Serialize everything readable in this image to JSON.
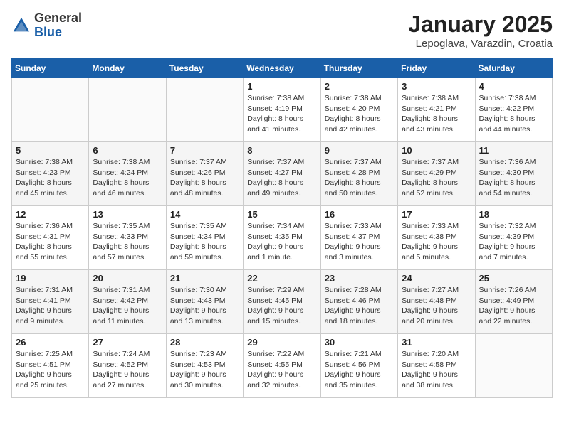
{
  "header": {
    "logo": {
      "general": "General",
      "blue": "Blue"
    },
    "title": "January 2025",
    "location": "Lepoglava, Varazdin, Croatia"
  },
  "weekdays": [
    "Sunday",
    "Monday",
    "Tuesday",
    "Wednesday",
    "Thursday",
    "Friday",
    "Saturday"
  ],
  "weeks": [
    [
      {
        "day": "",
        "info": ""
      },
      {
        "day": "",
        "info": ""
      },
      {
        "day": "",
        "info": ""
      },
      {
        "day": "1",
        "info": "Sunrise: 7:38 AM\nSunset: 4:19 PM\nDaylight: 8 hours\nand 41 minutes."
      },
      {
        "day": "2",
        "info": "Sunrise: 7:38 AM\nSunset: 4:20 PM\nDaylight: 8 hours\nand 42 minutes."
      },
      {
        "day": "3",
        "info": "Sunrise: 7:38 AM\nSunset: 4:21 PM\nDaylight: 8 hours\nand 43 minutes."
      },
      {
        "day": "4",
        "info": "Sunrise: 7:38 AM\nSunset: 4:22 PM\nDaylight: 8 hours\nand 44 minutes."
      }
    ],
    [
      {
        "day": "5",
        "info": "Sunrise: 7:38 AM\nSunset: 4:23 PM\nDaylight: 8 hours\nand 45 minutes."
      },
      {
        "day": "6",
        "info": "Sunrise: 7:38 AM\nSunset: 4:24 PM\nDaylight: 8 hours\nand 46 minutes."
      },
      {
        "day": "7",
        "info": "Sunrise: 7:37 AM\nSunset: 4:26 PM\nDaylight: 8 hours\nand 48 minutes."
      },
      {
        "day": "8",
        "info": "Sunrise: 7:37 AM\nSunset: 4:27 PM\nDaylight: 8 hours\nand 49 minutes."
      },
      {
        "day": "9",
        "info": "Sunrise: 7:37 AM\nSunset: 4:28 PM\nDaylight: 8 hours\nand 50 minutes."
      },
      {
        "day": "10",
        "info": "Sunrise: 7:37 AM\nSunset: 4:29 PM\nDaylight: 8 hours\nand 52 minutes."
      },
      {
        "day": "11",
        "info": "Sunrise: 7:36 AM\nSunset: 4:30 PM\nDaylight: 8 hours\nand 54 minutes."
      }
    ],
    [
      {
        "day": "12",
        "info": "Sunrise: 7:36 AM\nSunset: 4:31 PM\nDaylight: 8 hours\nand 55 minutes."
      },
      {
        "day": "13",
        "info": "Sunrise: 7:35 AM\nSunset: 4:33 PM\nDaylight: 8 hours\nand 57 minutes."
      },
      {
        "day": "14",
        "info": "Sunrise: 7:35 AM\nSunset: 4:34 PM\nDaylight: 8 hours\nand 59 minutes."
      },
      {
        "day": "15",
        "info": "Sunrise: 7:34 AM\nSunset: 4:35 PM\nDaylight: 9 hours\nand 1 minute."
      },
      {
        "day": "16",
        "info": "Sunrise: 7:33 AM\nSunset: 4:37 PM\nDaylight: 9 hours\nand 3 minutes."
      },
      {
        "day": "17",
        "info": "Sunrise: 7:33 AM\nSunset: 4:38 PM\nDaylight: 9 hours\nand 5 minutes."
      },
      {
        "day": "18",
        "info": "Sunrise: 7:32 AM\nSunset: 4:39 PM\nDaylight: 9 hours\nand 7 minutes."
      }
    ],
    [
      {
        "day": "19",
        "info": "Sunrise: 7:31 AM\nSunset: 4:41 PM\nDaylight: 9 hours\nand 9 minutes."
      },
      {
        "day": "20",
        "info": "Sunrise: 7:31 AM\nSunset: 4:42 PM\nDaylight: 9 hours\nand 11 minutes."
      },
      {
        "day": "21",
        "info": "Sunrise: 7:30 AM\nSunset: 4:43 PM\nDaylight: 9 hours\nand 13 minutes."
      },
      {
        "day": "22",
        "info": "Sunrise: 7:29 AM\nSunset: 4:45 PM\nDaylight: 9 hours\nand 15 minutes."
      },
      {
        "day": "23",
        "info": "Sunrise: 7:28 AM\nSunset: 4:46 PM\nDaylight: 9 hours\nand 18 minutes."
      },
      {
        "day": "24",
        "info": "Sunrise: 7:27 AM\nSunset: 4:48 PM\nDaylight: 9 hours\nand 20 minutes."
      },
      {
        "day": "25",
        "info": "Sunrise: 7:26 AM\nSunset: 4:49 PM\nDaylight: 9 hours\nand 22 minutes."
      }
    ],
    [
      {
        "day": "26",
        "info": "Sunrise: 7:25 AM\nSunset: 4:51 PM\nDaylight: 9 hours\nand 25 minutes."
      },
      {
        "day": "27",
        "info": "Sunrise: 7:24 AM\nSunset: 4:52 PM\nDaylight: 9 hours\nand 27 minutes."
      },
      {
        "day": "28",
        "info": "Sunrise: 7:23 AM\nSunset: 4:53 PM\nDaylight: 9 hours\nand 30 minutes."
      },
      {
        "day": "29",
        "info": "Sunrise: 7:22 AM\nSunset: 4:55 PM\nDaylight: 9 hours\nand 32 minutes."
      },
      {
        "day": "30",
        "info": "Sunrise: 7:21 AM\nSunset: 4:56 PM\nDaylight: 9 hours\nand 35 minutes."
      },
      {
        "day": "31",
        "info": "Sunrise: 7:20 AM\nSunset: 4:58 PM\nDaylight: 9 hours\nand 38 minutes."
      },
      {
        "day": "",
        "info": ""
      }
    ]
  ]
}
